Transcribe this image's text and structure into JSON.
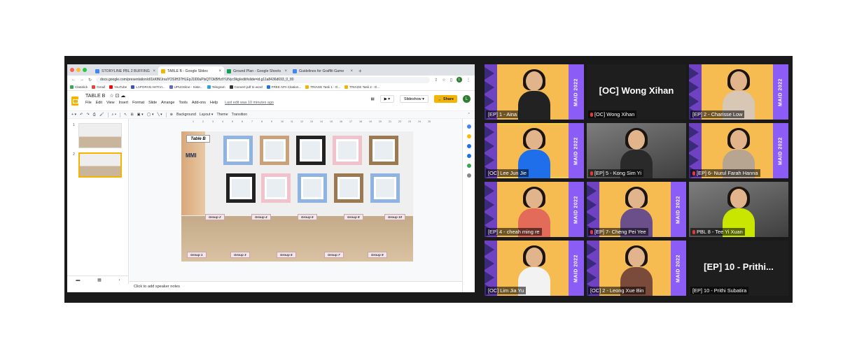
{
  "browser": {
    "tabs": [
      {
        "label": "STORYLINE PBL 2 BUFFING",
        "color": "#4285f4",
        "active": false
      },
      {
        "label": "TABLE B - Google Slides",
        "color": "#f4b400",
        "active": true
      },
      {
        "label": "Ground Plan - Google Sheets",
        "color": "#0f9d58",
        "active": false
      },
      {
        "label": "Guidelines for Graffiti Game",
        "color": "#4285f4",
        "active": false
      }
    ],
    "new_tab": "+",
    "close_glyph": "×",
    "url": "docs.google.com/presentation/d/1kKfMJrxaYOSIH37HLEpJ1l00uPlsQTOkBHztYUNyc9kg/edit#slide=id.g11a8436d693_0_80",
    "bookmarks": [
      "Classlick",
      "Gmail",
      "YouTube",
      "LAPORAN AKTIVI...",
      "UPUOnline - Siste...",
      "Telegram",
      "Convert pdf to word",
      "FREE APA Citation...",
      "TRIAGE Task 1 - G...",
      "TRIAGE Task 2 - G..."
    ]
  },
  "slides": {
    "title": "TABLE B",
    "menu": [
      "File",
      "Edit",
      "View",
      "Insert",
      "Format",
      "Slide",
      "Arrange",
      "Tools",
      "Add-ons",
      "Help"
    ],
    "last_edit": "Last edit was 10 minutes ago",
    "slideshow_label": "Slideshow",
    "share_label": "Share",
    "avatar_letter": "L",
    "toolbar": [
      "Background",
      "Layout",
      "Theme",
      "Transition"
    ],
    "thumbnail_numbers": [
      "1",
      "2"
    ],
    "ruler": [
      "1",
      "2",
      "3",
      "4",
      "5",
      "6",
      "7",
      "8",
      "9",
      "10",
      "11",
      "12",
      "13",
      "14",
      "15",
      "16",
      "17",
      "18",
      "19",
      "20",
      "21",
      "22",
      "23",
      "24",
      "25"
    ],
    "slide": {
      "table_title": "Table B",
      "logo": "MMI",
      "group_tags": [
        "Group 2",
        "Group 4",
        "Group 6",
        "Group 8",
        "Group 10",
        "Group 1",
        "Group 3",
        "Group 5",
        "Group 7",
        "Group 9"
      ]
    },
    "speaker_notes": "Click to add speaker notes"
  },
  "zoom": {
    "banner": "MAID 2022",
    "participants": [
      {
        "name": "[EP] 1 - Aina",
        "style": "maid",
        "shirt": "#222222",
        "muted": false
      },
      {
        "name": "[OC] Wong Xihan",
        "style": "dark",
        "big": "[OC] Wong Xihan",
        "muted": true
      },
      {
        "name": "[EP] 2 - Charisse Low",
        "style": "maid",
        "shirt": "#d8c7b5",
        "muted": false
      },
      {
        "name": "[OC] Lee Jun Jie",
        "style": "maid",
        "shirt": "#1f6feb",
        "muted": false,
        "selected": true
      },
      {
        "name": "[EP] 5 - Kong Sim Yi",
        "style": "cam",
        "shirt": "#2a2a2a",
        "muted": true
      },
      {
        "name": "[EP] 6- Nurul Farah Hanna",
        "style": "maid",
        "shirt": "#b7a591",
        "muted": true
      },
      {
        "name": "[EP] 4 - cheah ming re",
        "style": "maid",
        "shirt": "#e26b5a",
        "muted": false
      },
      {
        "name": "[EP] 7- Cheng Pei Yee",
        "style": "maid",
        "shirt": "#6b4f8a",
        "muted": true
      },
      {
        "name": "PBL 8 - Tee Yi Xuan",
        "style": "cam",
        "shirt": "#c8e600",
        "muted": true
      },
      {
        "name": "[OC] Lim Jia Yu",
        "style": "maid",
        "shirt": "#f2f2f2",
        "muted": false
      },
      {
        "name": "[OC] 2 - Leong Xue Bin",
        "style": "maid",
        "shirt": "#7a4b3a",
        "muted": false
      },
      {
        "name": "[EP] 10 - Prithi Subatira",
        "style": "dark",
        "big": "[EP] 10 - Prithi...",
        "muted": false
      }
    ]
  }
}
